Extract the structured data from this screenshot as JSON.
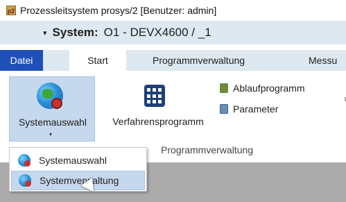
{
  "window": {
    "app_icon_text": "p2",
    "title": "Prozessleitsystem prosys/2  [Benutzer: admin]"
  },
  "system_bar": {
    "quick_access_glyph": "▾",
    "label": "System:",
    "value": "O1 - DEVX4600 / _1"
  },
  "tabs": [
    {
      "label": "Datei",
      "active": false
    },
    {
      "label": "Start",
      "active": true
    },
    {
      "label": "Programmverwaltung",
      "active": false
    },
    {
      "label": "Messu",
      "active": false
    }
  ],
  "ribbon": {
    "systemauswahl_label": "Systemauswahl",
    "systemauswahl_caret": "▾",
    "verfahrensprogramm_label": "Verfahrensprogramm",
    "ablaufprogramm_label": "Ablaufprogramm",
    "parameter_label": "Parameter",
    "group_label": "Programmverwaltung"
  },
  "dropdown": {
    "items": [
      {
        "label": "Systemauswahl",
        "icon": "globe-gear-icon"
      },
      {
        "label": "Systemverwaltung",
        "icon": "globe-gear-icon",
        "hovered": true
      }
    ]
  },
  "colors": {
    "accent_blue": "#1f4fb8",
    "bar_background": "#dde8f0",
    "hover_background": "#c5d8ee",
    "disabled_area": "#ababab"
  }
}
